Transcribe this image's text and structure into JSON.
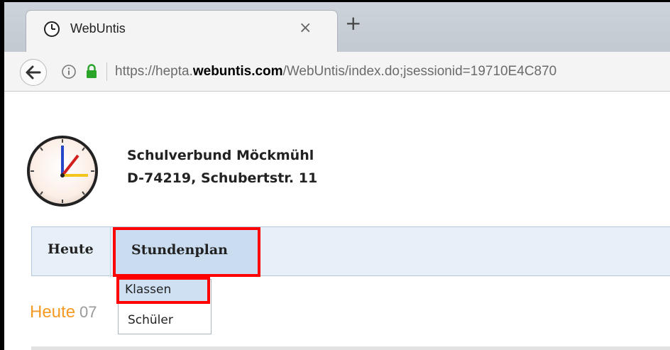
{
  "browser": {
    "tab": {
      "title": "WebUntis",
      "close_glyph": "×"
    },
    "new_tab_glyph": "+",
    "url": {
      "prefix": "https://hepta.",
      "domain": "webuntis.com",
      "path": "/WebUntis/index.do;jsessionid=19710E4C870"
    },
    "icons": {
      "tab": "clock-icon",
      "back": "back-arrow-icon",
      "info": "info-icon",
      "lock": "lock-icon"
    }
  },
  "school": {
    "name": "Schulverbund Möckmühl",
    "address": "D-74219, Schubertstr. 11",
    "logo": "clock-logo"
  },
  "menu": {
    "items": [
      {
        "label": "Heute"
      },
      {
        "label": "Stundenplan"
      }
    ],
    "dropdown": [
      {
        "label": "Klassen"
      },
      {
        "label": "Schüler"
      }
    ]
  },
  "main": {
    "heading": "Heute",
    "date_partial": "07"
  },
  "colors": {
    "highlight": "#ff0000",
    "heading": "#f59a23",
    "menu_bg": "#e7f0f8",
    "lock": "#2aa52a"
  }
}
